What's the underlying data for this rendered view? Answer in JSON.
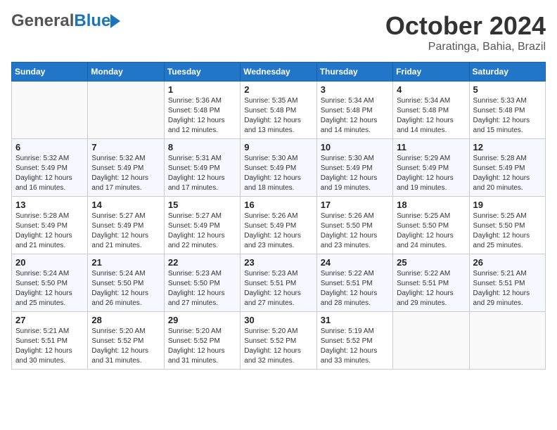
{
  "header": {
    "logo_general": "General",
    "logo_blue": "Blue",
    "month": "October 2024",
    "location": "Paratinga, Bahia, Brazil"
  },
  "days_of_week": [
    "Sunday",
    "Monday",
    "Tuesday",
    "Wednesday",
    "Thursday",
    "Friday",
    "Saturday"
  ],
  "weeks": [
    [
      {
        "day": "",
        "sunrise": "",
        "sunset": "",
        "daylight": ""
      },
      {
        "day": "",
        "sunrise": "",
        "sunset": "",
        "daylight": ""
      },
      {
        "day": "1",
        "sunrise": "Sunrise: 5:36 AM",
        "sunset": "Sunset: 5:48 PM",
        "daylight": "Daylight: 12 hours and 12 minutes."
      },
      {
        "day": "2",
        "sunrise": "Sunrise: 5:35 AM",
        "sunset": "Sunset: 5:48 PM",
        "daylight": "Daylight: 12 hours and 13 minutes."
      },
      {
        "day": "3",
        "sunrise": "Sunrise: 5:34 AM",
        "sunset": "Sunset: 5:48 PM",
        "daylight": "Daylight: 12 hours and 14 minutes."
      },
      {
        "day": "4",
        "sunrise": "Sunrise: 5:34 AM",
        "sunset": "Sunset: 5:48 PM",
        "daylight": "Daylight: 12 hours and 14 minutes."
      },
      {
        "day": "5",
        "sunrise": "Sunrise: 5:33 AM",
        "sunset": "Sunset: 5:48 PM",
        "daylight": "Daylight: 12 hours and 15 minutes."
      }
    ],
    [
      {
        "day": "6",
        "sunrise": "Sunrise: 5:32 AM",
        "sunset": "Sunset: 5:49 PM",
        "daylight": "Daylight: 12 hours and 16 minutes."
      },
      {
        "day": "7",
        "sunrise": "Sunrise: 5:32 AM",
        "sunset": "Sunset: 5:49 PM",
        "daylight": "Daylight: 12 hours and 17 minutes."
      },
      {
        "day": "8",
        "sunrise": "Sunrise: 5:31 AM",
        "sunset": "Sunset: 5:49 PM",
        "daylight": "Daylight: 12 hours and 17 minutes."
      },
      {
        "day": "9",
        "sunrise": "Sunrise: 5:30 AM",
        "sunset": "Sunset: 5:49 PM",
        "daylight": "Daylight: 12 hours and 18 minutes."
      },
      {
        "day": "10",
        "sunrise": "Sunrise: 5:30 AM",
        "sunset": "Sunset: 5:49 PM",
        "daylight": "Daylight: 12 hours and 19 minutes."
      },
      {
        "day": "11",
        "sunrise": "Sunrise: 5:29 AM",
        "sunset": "Sunset: 5:49 PM",
        "daylight": "Daylight: 12 hours and 19 minutes."
      },
      {
        "day": "12",
        "sunrise": "Sunrise: 5:28 AM",
        "sunset": "Sunset: 5:49 PM",
        "daylight": "Daylight: 12 hours and 20 minutes."
      }
    ],
    [
      {
        "day": "13",
        "sunrise": "Sunrise: 5:28 AM",
        "sunset": "Sunset: 5:49 PM",
        "daylight": "Daylight: 12 hours and 21 minutes."
      },
      {
        "day": "14",
        "sunrise": "Sunrise: 5:27 AM",
        "sunset": "Sunset: 5:49 PM",
        "daylight": "Daylight: 12 hours and 21 minutes."
      },
      {
        "day": "15",
        "sunrise": "Sunrise: 5:27 AM",
        "sunset": "Sunset: 5:49 PM",
        "daylight": "Daylight: 12 hours and 22 minutes."
      },
      {
        "day": "16",
        "sunrise": "Sunrise: 5:26 AM",
        "sunset": "Sunset: 5:49 PM",
        "daylight": "Daylight: 12 hours and 23 minutes."
      },
      {
        "day": "17",
        "sunrise": "Sunrise: 5:26 AM",
        "sunset": "Sunset: 5:50 PM",
        "daylight": "Daylight: 12 hours and 23 minutes."
      },
      {
        "day": "18",
        "sunrise": "Sunrise: 5:25 AM",
        "sunset": "Sunset: 5:50 PM",
        "daylight": "Daylight: 12 hours and 24 minutes."
      },
      {
        "day": "19",
        "sunrise": "Sunrise: 5:25 AM",
        "sunset": "Sunset: 5:50 PM",
        "daylight": "Daylight: 12 hours and 25 minutes."
      }
    ],
    [
      {
        "day": "20",
        "sunrise": "Sunrise: 5:24 AM",
        "sunset": "Sunset: 5:50 PM",
        "daylight": "Daylight: 12 hours and 25 minutes."
      },
      {
        "day": "21",
        "sunrise": "Sunrise: 5:24 AM",
        "sunset": "Sunset: 5:50 PM",
        "daylight": "Daylight: 12 hours and 26 minutes."
      },
      {
        "day": "22",
        "sunrise": "Sunrise: 5:23 AM",
        "sunset": "Sunset: 5:50 PM",
        "daylight": "Daylight: 12 hours and 27 minutes."
      },
      {
        "day": "23",
        "sunrise": "Sunrise: 5:23 AM",
        "sunset": "Sunset: 5:51 PM",
        "daylight": "Daylight: 12 hours and 27 minutes."
      },
      {
        "day": "24",
        "sunrise": "Sunrise: 5:22 AM",
        "sunset": "Sunset: 5:51 PM",
        "daylight": "Daylight: 12 hours and 28 minutes."
      },
      {
        "day": "25",
        "sunrise": "Sunrise: 5:22 AM",
        "sunset": "Sunset: 5:51 PM",
        "daylight": "Daylight: 12 hours and 29 minutes."
      },
      {
        "day": "26",
        "sunrise": "Sunrise: 5:21 AM",
        "sunset": "Sunset: 5:51 PM",
        "daylight": "Daylight: 12 hours and 29 minutes."
      }
    ],
    [
      {
        "day": "27",
        "sunrise": "Sunrise: 5:21 AM",
        "sunset": "Sunset: 5:51 PM",
        "daylight": "Daylight: 12 hours and 30 minutes."
      },
      {
        "day": "28",
        "sunrise": "Sunrise: 5:20 AM",
        "sunset": "Sunset: 5:52 PM",
        "daylight": "Daylight: 12 hours and 31 minutes."
      },
      {
        "day": "29",
        "sunrise": "Sunrise: 5:20 AM",
        "sunset": "Sunset: 5:52 PM",
        "daylight": "Daylight: 12 hours and 31 minutes."
      },
      {
        "day": "30",
        "sunrise": "Sunrise: 5:20 AM",
        "sunset": "Sunset: 5:52 PM",
        "daylight": "Daylight: 12 hours and 32 minutes."
      },
      {
        "day": "31",
        "sunrise": "Sunrise: 5:19 AM",
        "sunset": "Sunset: 5:52 PM",
        "daylight": "Daylight: 12 hours and 33 minutes."
      },
      {
        "day": "",
        "sunrise": "",
        "sunset": "",
        "daylight": ""
      },
      {
        "day": "",
        "sunrise": "",
        "sunset": "",
        "daylight": ""
      }
    ]
  ]
}
